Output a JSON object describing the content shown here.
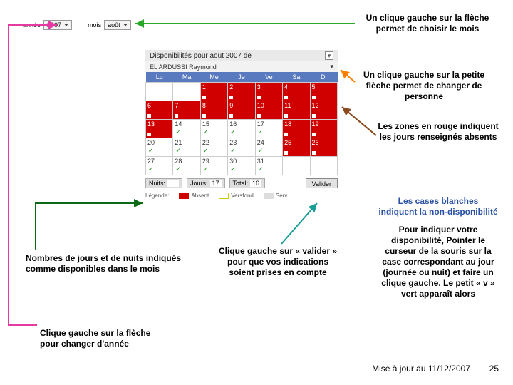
{
  "dropdowns": {
    "year_label": "année",
    "year_value": "2007",
    "month_label": "mois",
    "month_value": "août"
  },
  "calendar": {
    "title": "Disponibilités pour aout 2007 de",
    "person": "EL ARDUSSI Raymond",
    "weekdays": [
      "Lu",
      "Ma",
      "Me",
      "Je",
      "Ve",
      "Sa",
      "Di"
    ],
    "rows": [
      [
        {
          "d": "",
          "red": false
        },
        {
          "d": "",
          "red": false
        },
        {
          "d": "1",
          "red": true
        },
        {
          "d": "2",
          "red": true
        },
        {
          "d": "3",
          "red": true
        },
        {
          "d": "4",
          "red": true
        },
        {
          "d": "5",
          "red": true
        }
      ],
      [
        {
          "d": "6",
          "red": true
        },
        {
          "d": "7",
          "red": true
        },
        {
          "d": "8",
          "red": true
        },
        {
          "d": "9",
          "red": true
        },
        {
          "d": "10",
          "red": true
        },
        {
          "d": "11",
          "red": true
        },
        {
          "d": "12",
          "red": true
        }
      ],
      [
        {
          "d": "13",
          "red": true
        },
        {
          "d": "14",
          "red": false,
          "mark": true
        },
        {
          "d": "15",
          "red": false,
          "mark": true
        },
        {
          "d": "16",
          "red": false,
          "mark": true
        },
        {
          "d": "17",
          "red": false,
          "mark": true
        },
        {
          "d": "18",
          "red": true
        },
        {
          "d": "19",
          "red": true
        }
      ],
      [
        {
          "d": "20",
          "red": false,
          "mark": true
        },
        {
          "d": "21",
          "red": false,
          "mark": true
        },
        {
          "d": "22",
          "red": false,
          "mark": true
        },
        {
          "d": "23",
          "red": false,
          "mark": true
        },
        {
          "d": "24",
          "red": false,
          "mark": true
        },
        {
          "d": "25",
          "red": true
        },
        {
          "d": "26",
          "red": true
        }
      ],
      [
        {
          "d": "27",
          "red": false,
          "mark": true
        },
        {
          "d": "28",
          "red": false,
          "mark": true
        },
        {
          "d": "29",
          "red": false,
          "mark": true
        },
        {
          "d": "30",
          "red": false,
          "mark": true
        },
        {
          "d": "31",
          "red": false,
          "mark": true
        },
        {
          "d": "",
          "red": false
        },
        {
          "d": "",
          "red": false
        }
      ]
    ],
    "footer": {
      "night_label": "Nuits:",
      "night_val": "",
      "days_label": "Jours:",
      "days_val": "17",
      "total_label": "Total:",
      "total_val": "16",
      "validate": "Valider"
    },
    "legend": {
      "label": "Légende:",
      "absent": "Absent",
      "versfond": "Versfond",
      "serv": "Serv"
    }
  },
  "ann": {
    "a1": "Un clique gauche sur la flèche permet de choisir le mois",
    "a2": "Un clique gauche sur la petite flèche permet de changer de personne",
    "a3": "Les zones en rouge indiquent les jours renseignés absents",
    "a4_title": "Les cases blanches indiquent la non-disponibilité",
    "a4_body": "Pour indiquer votre disponibilité, Pointer le curseur de la souris sur la case correspondant au jour (journée ou nuit) et faire un clique gauche. Le petit « v » vert apparaît alors",
    "a5": "Nombres de jours et de nuits indiqués comme disponibles dans le mois",
    "a6": "Clique gauche sur « valider » pour que vos indications soient prises en compte",
    "a7": "Clique gauche sur la flèche pour changer d'année"
  },
  "footer": {
    "date": "Mise à jour au 11/12/2007",
    "page": "25"
  }
}
